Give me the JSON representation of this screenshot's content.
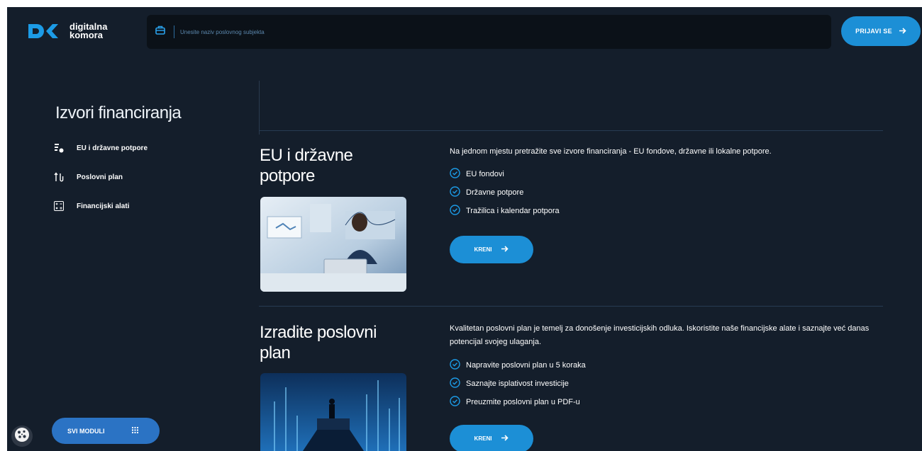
{
  "header": {
    "logo_line1": "digitalna",
    "logo_line2": "komora",
    "search_placeholder": "Unesite naziv poslovnog subjekta",
    "login_label": "PRIJAVI SE"
  },
  "sidebar": {
    "title": "Izvori financiranja",
    "items": [
      {
        "label": "EU i državne potpore",
        "icon": "funding-icon"
      },
      {
        "label": "Poslovni plan",
        "icon": "plan-icon"
      },
      {
        "label": "Financijski alati",
        "icon": "calculator-icon"
      }
    ],
    "all_modules_label": "SVI MODULI"
  },
  "sections": [
    {
      "title_line1": "EU i državne",
      "title_line2": "potpore",
      "description": "Na jednom mjestu pretražite sve izvore financiranja - EU fondove, državne ili lokalne potpore.",
      "checks": [
        "EU fondovi",
        "Državne potpore",
        "Tražilica i kalendar potpora"
      ],
      "button_label": "KRENI"
    },
    {
      "title_line1": "Izradite poslovni",
      "title_line2": "plan",
      "description": "Kvalitetan poslovni plan je temelj za donošenje investicijskih odluka. Iskoristite naše financijske alate i saznajte već danas potencijal svojeg ulaganja.",
      "checks": [
        "Napravite poslovni plan u 5 koraka",
        "Saznajte isplativost investicije",
        "Preuzmite poslovni plan u PDF-u"
      ],
      "button_label": "KRENI"
    }
  ],
  "colors": {
    "background": "#141e2b",
    "accent": "#1c8fd6",
    "secondary_button": "#2b73c4"
  }
}
